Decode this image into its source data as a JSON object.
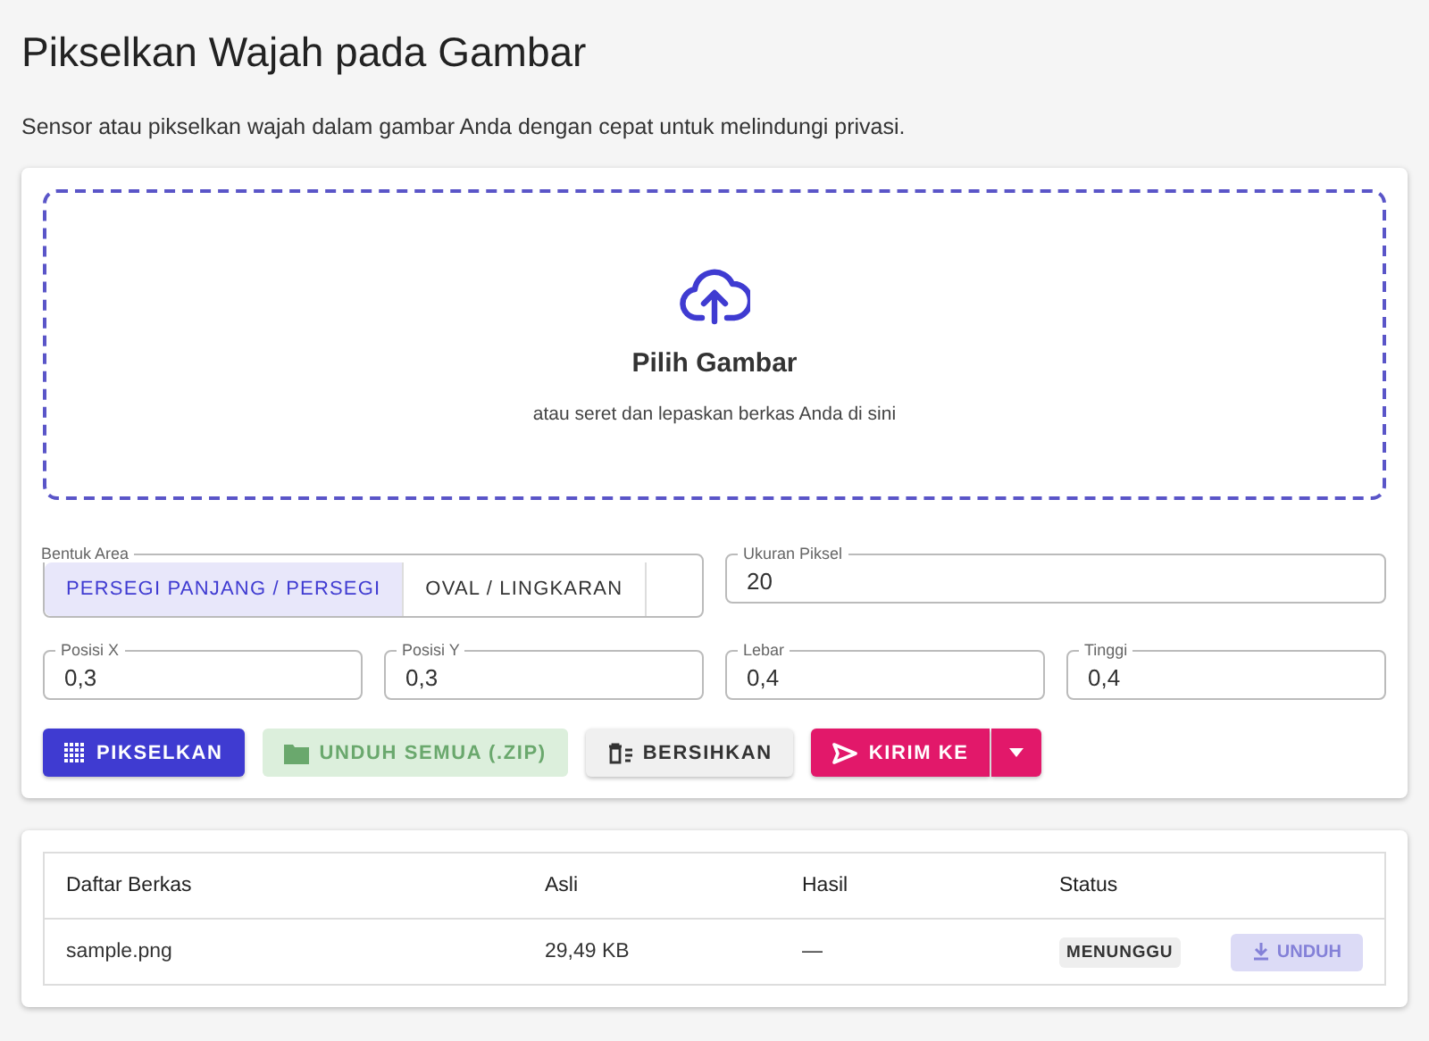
{
  "page": {
    "title": "Pikselkan Wajah pada Gambar",
    "subtitle": "Sensor atau pikselkan wajah dalam gambar Anda dengan cepat untuk melindungi privasi."
  },
  "dropzone": {
    "title": "Pilih Gambar",
    "hint": "atau seret dan lepaskan berkas Anda di sini"
  },
  "shape": {
    "label": "Bentuk Area",
    "options": [
      {
        "label": "PERSEGI PANJANG / PERSEGI",
        "selected": true
      },
      {
        "label": "OVAL / LINGKARAN",
        "selected": false
      }
    ]
  },
  "pixel_size": {
    "label": "Ukuran Piksel",
    "value": "20"
  },
  "fields": [
    {
      "label": "Posisi X",
      "value": "0,3"
    },
    {
      "label": "Posisi Y",
      "value": "0,3"
    },
    {
      "label": "Lebar",
      "value": "0,4"
    },
    {
      "label": "Tinggi",
      "value": "0,4"
    }
  ],
  "buttons": [
    {
      "kind": "primary",
      "label": "PIKSELKAN",
      "disabled": false
    },
    {
      "kind": "success",
      "label": "UNDUH SEMUA (.ZIP)",
      "disabled": true
    },
    {
      "kind": "plain",
      "label": "BERSIHKAN",
      "disabled": false
    },
    {
      "kind": "split",
      "label": "KIRIM KE",
      "disabled": false
    }
  ],
  "table": {
    "columns": [
      "Daftar Berkas",
      "Asli",
      "Hasil",
      "Status"
    ],
    "rows": [
      {
        "name": "sample.png",
        "original": "29,49 KB",
        "result": "—",
        "status": "MENUNGGU",
        "action": {
          "label": "UNDUH",
          "disabled": true
        }
      }
    ]
  }
}
